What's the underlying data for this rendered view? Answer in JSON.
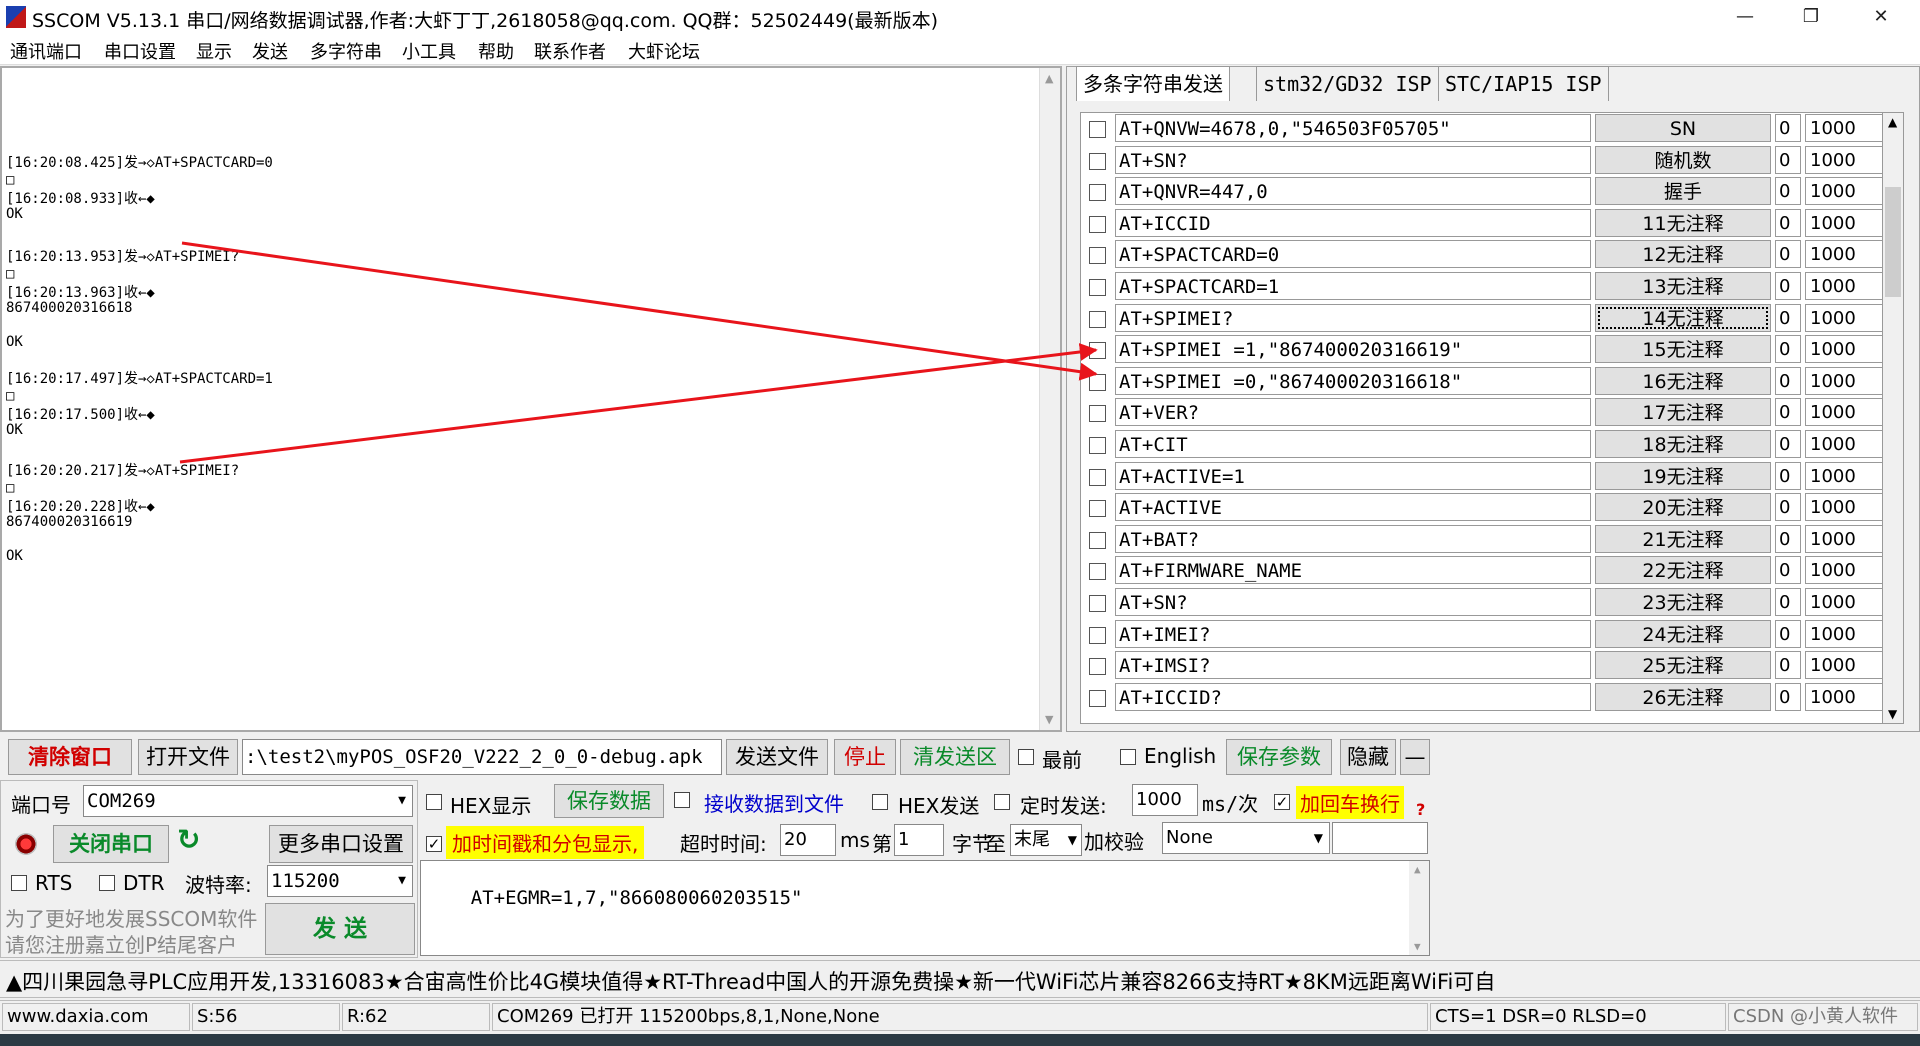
{
  "window": {
    "title": "SSCOM V5.13.1 串口/网络数据调试器,作者:大虾丁丁,2618058@qq.com. QQ群：52502449(最新版本)",
    "controls": [
      "—",
      "❐",
      "✕"
    ]
  },
  "menu": [
    "通讯端口",
    "串口设置",
    "显示",
    "发送",
    "多字符串",
    "小工具",
    "帮助",
    "联系作者",
    "大虾论坛"
  ],
  "log_lines": [
    "[16:20:08.425]发→◇AT+SPACTCARD=0",
    "□",
    "[16:20:08.933]收←◆",
    "OK",
    "",
    "[16:20:13.953]发→◇AT+SPIMEI?",
    "□",
    "[16:20:13.963]收←◆",
    "867400020316618",
    "",
    "OK",
    "",
    "[16:20:17.497]发→◇AT+SPACTCARD=1",
    "□",
    "[16:20:17.500]收←◆",
    "OK",
    "",
    "[16:20:20.217]发→◇AT+SPIMEI?",
    "□",
    "[16:20:20.228]收←◆",
    "867400020316619",
    "",
    "OK"
  ],
  "tabs": [
    "多条字符串发送",
    "stm32/GD32 ISP",
    "STC/IAP15 ISP"
  ],
  "multi_rows": [
    {
      "cmd": "AT+QNVW=4678,0,\"546503F05705\"",
      "btn": "SN",
      "order": "0",
      "delay": "1000"
    },
    {
      "cmd": "AT+SN?",
      "btn": "随机数",
      "order": "0",
      "delay": "1000"
    },
    {
      "cmd": "AT+QNVR=447,0",
      "btn": "握手",
      "order": "0",
      "delay": "1000"
    },
    {
      "cmd": "AT+ICCID",
      "btn": "11无注释",
      "order": "0",
      "delay": "1000"
    },
    {
      "cmd": "AT+SPACTCARD=0",
      "btn": "12无注释",
      "order": "0",
      "delay": "1000"
    },
    {
      "cmd": "AT+SPACTCARD=1",
      "btn": "13无注释",
      "order": "0",
      "delay": "1000"
    },
    {
      "cmd": "AT+SPIMEI?",
      "btn": "14无注释",
      "order": "0",
      "delay": "1000"
    },
    {
      "cmd": "AT+SPIMEI =1,\"867400020316619\"",
      "btn": "15无注释",
      "order": "0",
      "delay": "1000"
    },
    {
      "cmd": "AT+SPIMEI =0,\"867400020316618\"",
      "btn": "16无注释",
      "order": "0",
      "delay": "1000"
    },
    {
      "cmd": "AT+VER?",
      "btn": "17无注释",
      "order": "0",
      "delay": "1000"
    },
    {
      "cmd": "AT+CIT",
      "btn": "18无注释",
      "order": "0",
      "delay": "1000"
    },
    {
      "cmd": "AT+ACTIVE=1",
      "btn": "19无注释",
      "order": "0",
      "delay": "1000"
    },
    {
      "cmd": "AT+ACTIVE",
      "btn": "20无注释",
      "order": "0",
      "delay": "1000"
    },
    {
      "cmd": "AT+BAT?",
      "btn": "21无注释",
      "order": "0",
      "delay": "1000"
    },
    {
      "cmd": "AT+FIRMWARE_NAME",
      "btn": "22无注释",
      "order": "0",
      "delay": "1000"
    },
    {
      "cmd": "AT+SN?",
      "btn": "23无注释",
      "order": "0",
      "delay": "1000"
    },
    {
      "cmd": "AT+IMEI?",
      "btn": "24无注释",
      "order": "0",
      "delay": "1000"
    },
    {
      "cmd": "AT+IMSI?",
      "btn": "25无注释",
      "order": "0",
      "delay": "1000"
    },
    {
      "cmd": "AT+ICCID?",
      "btn": "26无注释",
      "order": "0",
      "delay": "1000"
    }
  ],
  "toolbar": {
    "clear": "清除窗口",
    "open_file": "打开文件",
    "file_path": ":\\test2\\myPOS_OSF20_V222_2_0_0-debug.apk",
    "send_file": "发送文件",
    "stop": "停止",
    "clear_send": "清发送区",
    "topmost": "最前",
    "english": "English",
    "save_params": "保存参数",
    "hide": "隐藏",
    "minus": "—"
  },
  "port": {
    "port_label": "端口号",
    "port_value": "COM269",
    "close_port": "关闭串口",
    "more_settings": "更多串口设置",
    "rts": "RTS",
    "dtr": "DTR",
    "baud_label": "波特率:",
    "baud_value": "115200",
    "promo1": "为了更好地发展SSCOM软件",
    "promo2": "请您注册嘉立创P结尾客户",
    "send": "发 送"
  },
  "options": {
    "hex_display": "HEX显示",
    "save_data": "保存数据",
    "recv_to_file": "接收数据到文件",
    "hex_send": "HEX发送",
    "timed_send": "定时发送:",
    "timed_value": "1000",
    "ms_per": "ms/次",
    "add_crlf": "加回车换行",
    "timestamp": "加时间戳和分包显示,",
    "timeout_label": "超时时间:",
    "timeout_value": "20",
    "ms": "ms",
    "nth": "第",
    "byte_value": "1",
    "byte_label": "字节",
    "to": "至",
    "end_value": "末尾",
    "checksum_label": "加校验",
    "checksum_value": "None",
    "help": "?"
  },
  "send_text": "AT+EGMR=1,7,\"866080060203515\"",
  "ticker": "▲四川果园急寻PLC应用开发,13316083★合宙高性价比4G模块值得★RT-Thread中国人的开源免费操★新一代WiFi芯片兼容8266支持RT★8KM远距离WiFi可自",
  "status": {
    "site": "www.daxia.com",
    "s": "S:56",
    "r": "R:62",
    "port_info": "COM269 已打开  115200bps,8,1,None,None",
    "lines": "CTS=1 DSR=0 RLSD=0",
    "watermark": "CSDN @小黄人软件"
  },
  "colors": {
    "arrow": "#e8141b",
    "green": "#0a8a2a",
    "red": "#d10000",
    "blue": "#0000cc"
  }
}
